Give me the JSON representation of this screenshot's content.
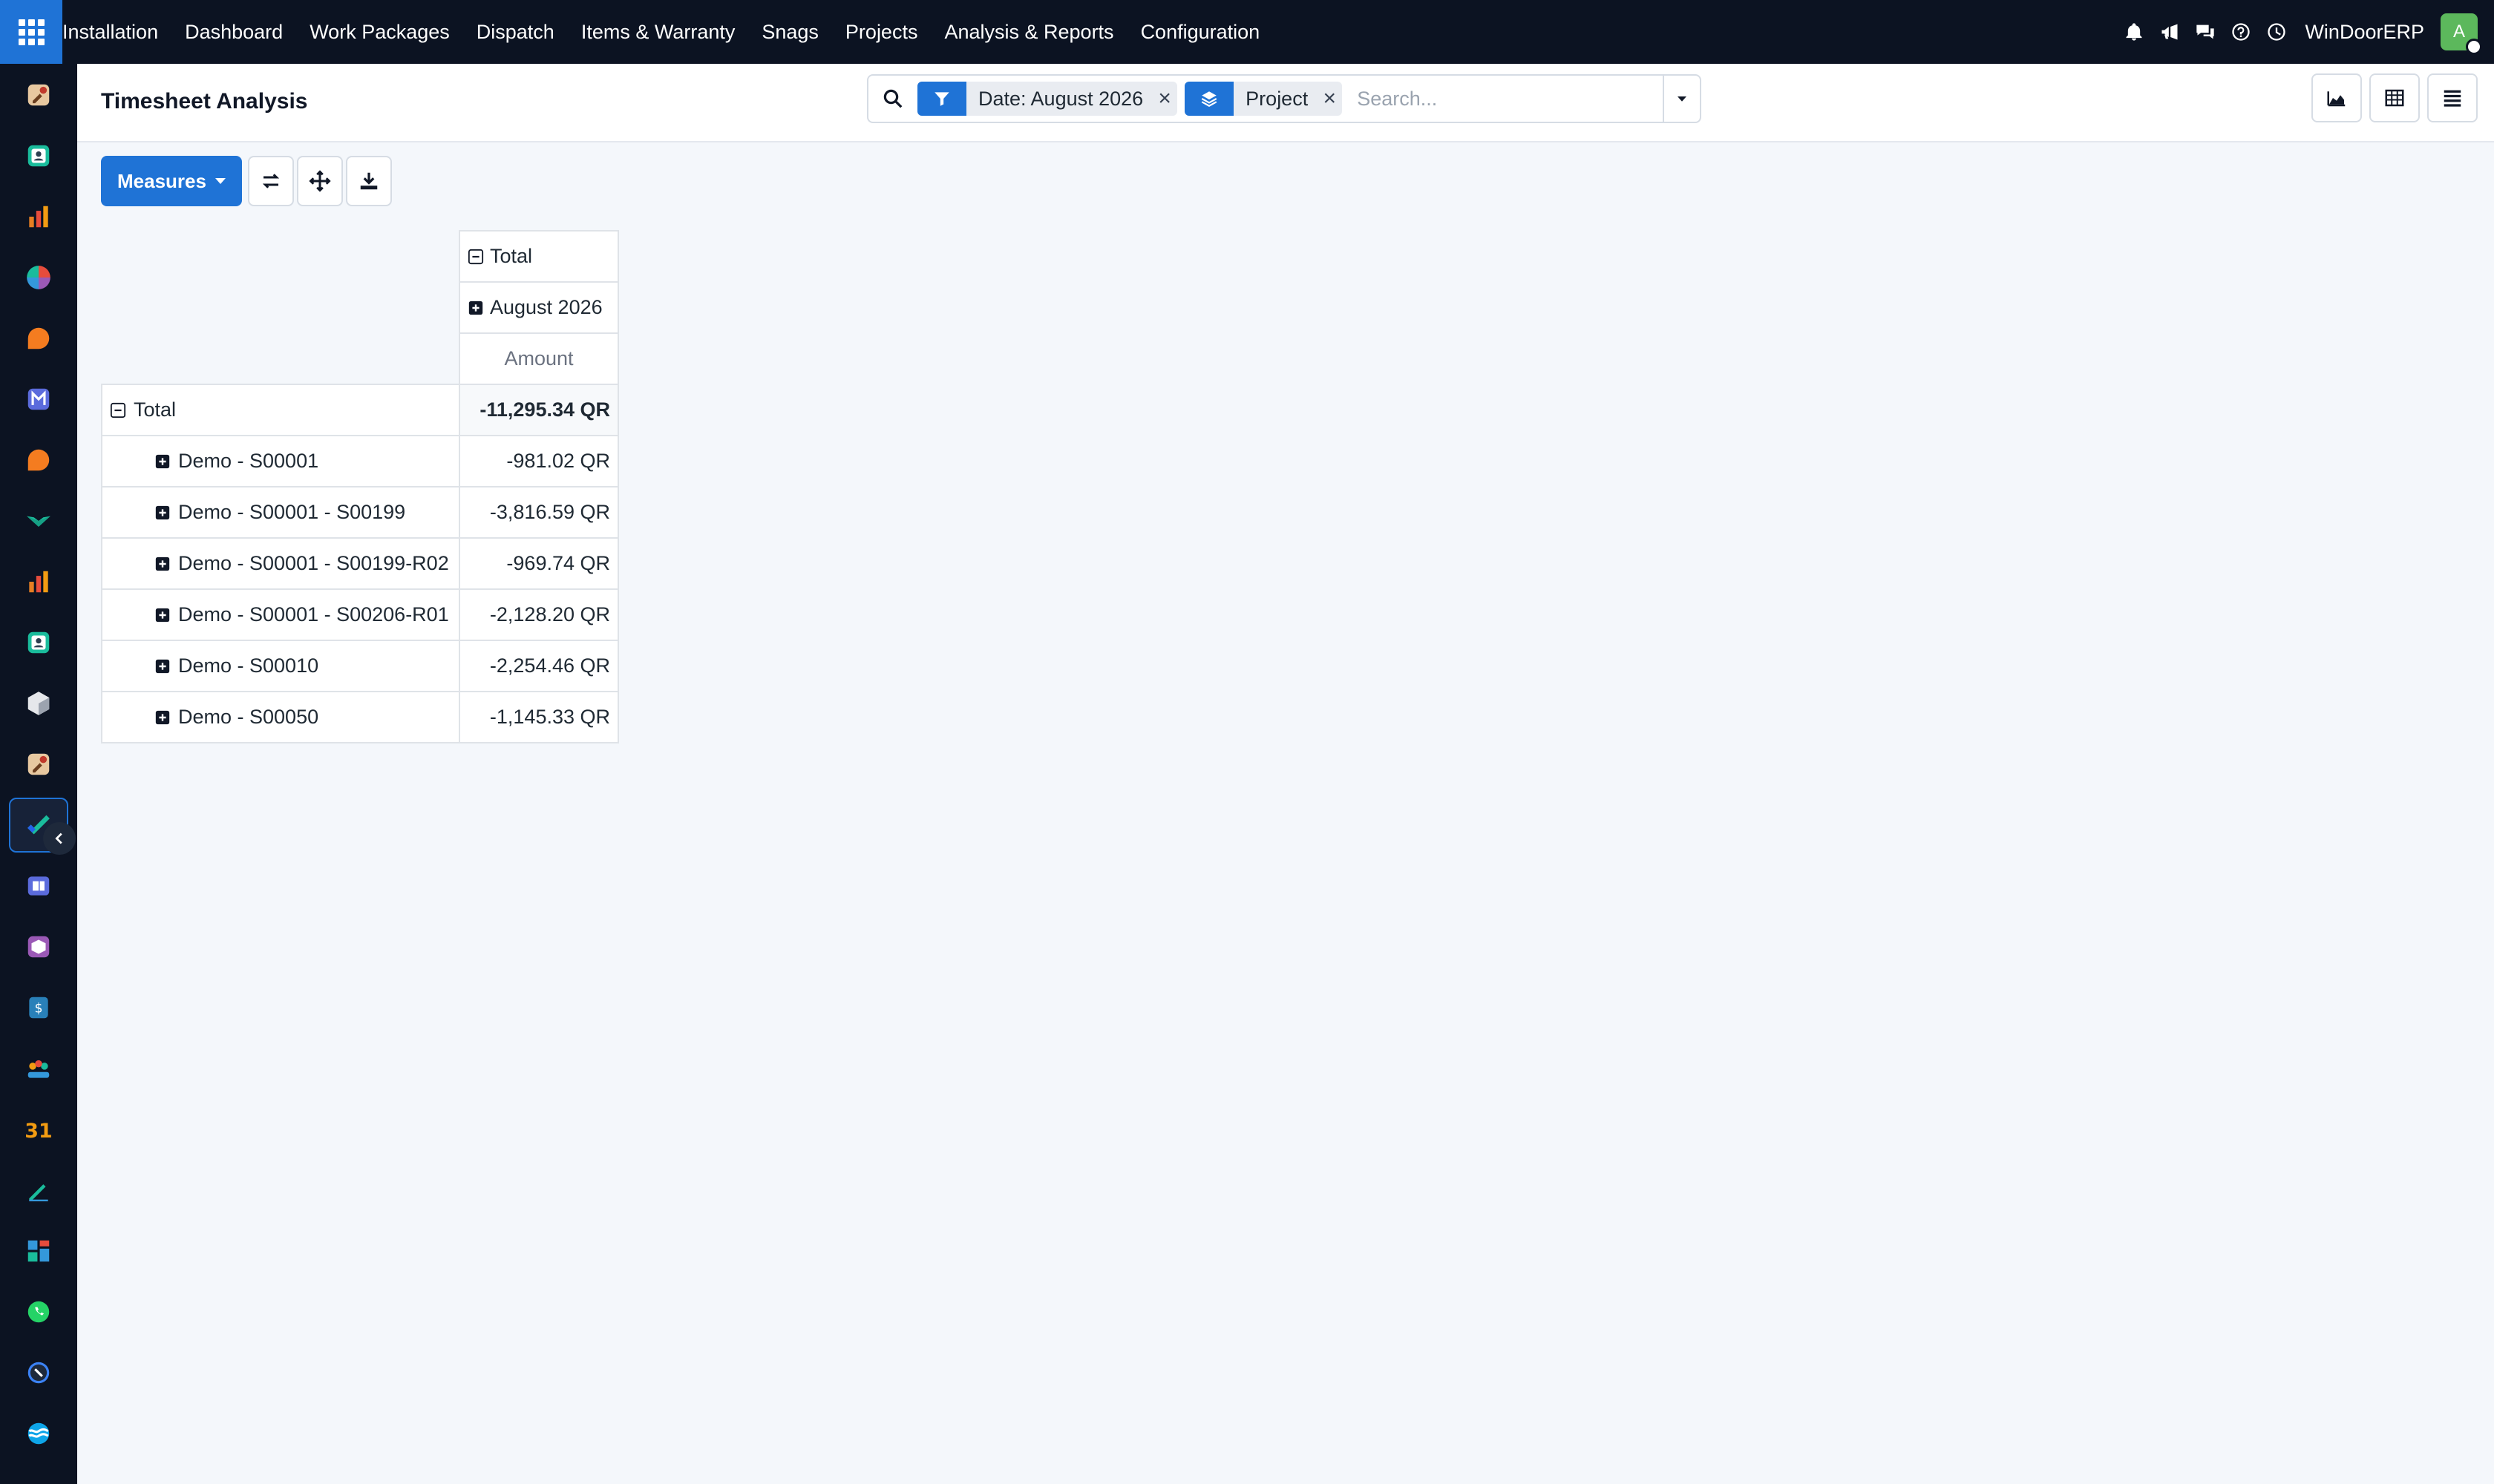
{
  "topnav": {
    "menu": [
      {
        "label": "Installation"
      },
      {
        "label": "Dashboard"
      },
      {
        "label": "Work Packages"
      },
      {
        "label": "Dispatch"
      },
      {
        "label": "Items & Warranty"
      },
      {
        "label": "Snags"
      },
      {
        "label": "Projects"
      },
      {
        "label": "Analysis & Reports"
      },
      {
        "label": "Configuration"
      }
    ],
    "company": "WinDoorERP",
    "avatar_initial": "A",
    "icons": [
      "bell-icon",
      "megaphone-icon",
      "chat-icon",
      "help-icon",
      "clock-icon"
    ]
  },
  "control": {
    "title": "Timesheet Analysis",
    "facets": [
      {
        "label": "Date: August 2026",
        "icon": "filter-icon"
      },
      {
        "label": "Project",
        "icon": "layers-icon"
      }
    ],
    "search_placeholder": "Search..."
  },
  "toolbar": {
    "measures_label": "Measures"
  },
  "pivot": {
    "col_total_label": "Total",
    "col_group_label": "August 2026",
    "measure_label": "Amount",
    "total_row": {
      "label": "Total",
      "value": "-11,295.34 QR"
    },
    "rows": [
      {
        "label": "Demo - S00001",
        "value": "-981.02 QR"
      },
      {
        "label": "Demo - S00001 - S00199",
        "value": "-3,816.59 QR"
      },
      {
        "label": "Demo - S00001 - S00199-R02",
        "value": "-969.74 QR"
      },
      {
        "label": "Demo - S00001 - S00206-R01",
        "value": "-2,128.20 QR"
      },
      {
        "label": "Demo - S00010",
        "value": "-2,254.46 QR"
      },
      {
        "label": "Demo - S00050",
        "value": "-1,145.33 QR"
      }
    ]
  },
  "colors": {
    "topbar": "#0c1322",
    "accent": "#1f73d6",
    "background": "#f4f7fb"
  }
}
